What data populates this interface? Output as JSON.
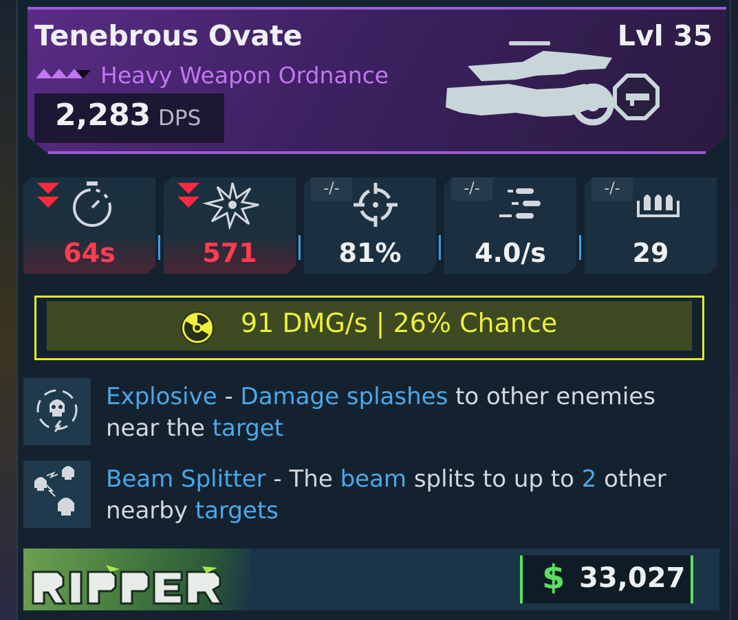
{
  "item": {
    "name": "Tenebrous Ovate",
    "level": "Lvl 35",
    "type": "Heavy Weapon Ordnance",
    "dps_value": "2,283",
    "dps_label": "DPS"
  },
  "stats": [
    {
      "icon": "stopwatch-icon",
      "value": "64s",
      "change": "decrease"
    },
    {
      "icon": "explosion-icon",
      "value": "571",
      "change": "decrease"
    },
    {
      "icon": "crosshair-icon",
      "value": "81%",
      "change": "none",
      "tag": "-/-"
    },
    {
      "icon": "fire-rate-icon",
      "value": "4.0/s",
      "change": "none",
      "tag": "-/-"
    },
    {
      "icon": "ammo-icon",
      "value": "29",
      "change": "none",
      "tag": "-/-"
    }
  ],
  "element": {
    "icon": "radiation-icon",
    "text": "91 DMG/s | 26% Chance",
    "color": "#eeef3a"
  },
  "perks": [
    {
      "icon": "explosive-skull-icon",
      "name": "Explosive",
      "sep": " - ",
      "t1": "Damage splashes",
      "t2": " to other enemies near the ",
      "t3": "target"
    },
    {
      "icon": "beam-splitter-skulls-icon",
      "name": "Beam Splitter",
      "sep": " - The ",
      "t1": "beam",
      "t2": " splits to up to ",
      "t3": "2",
      "t4": " other nearby ",
      "t5": "targets"
    }
  ],
  "footer": {
    "manufacturer_logo": "Ripper",
    "currency_icon": "$",
    "price": "33,027"
  },
  "colors": {
    "rarity": "#c276f2",
    "header_bg": "#4a2670",
    "negative": "#ff3c50",
    "keyword": "#4aa8e8",
    "money": "#5adf60"
  }
}
